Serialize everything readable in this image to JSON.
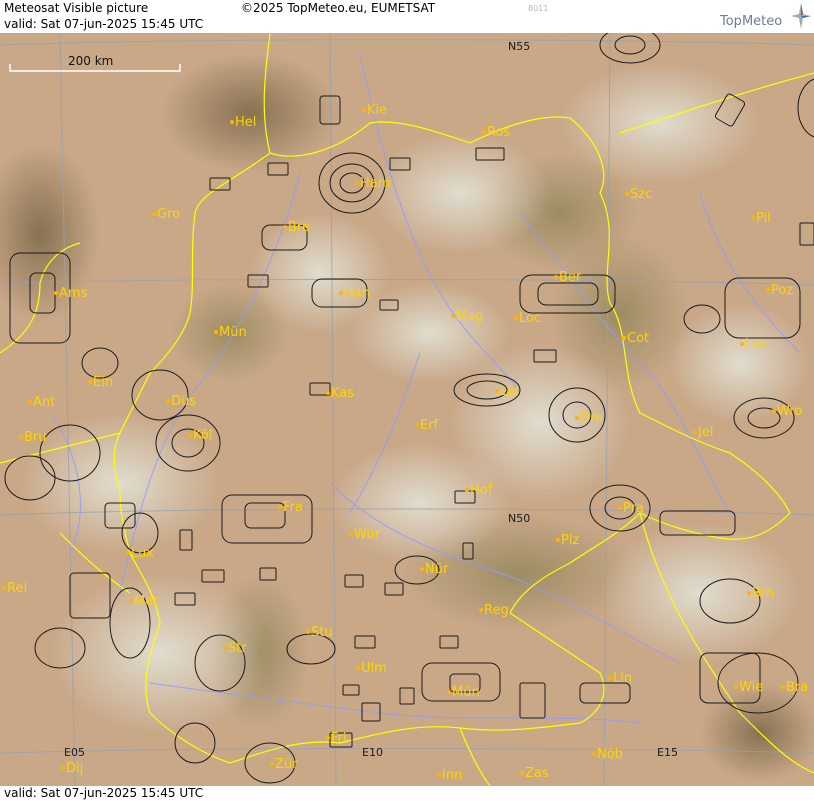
{
  "header": {
    "title": "Meteosat Visible picture",
    "valid": "valid:  Sat  07-jun-2025  15:45 UTC",
    "copyright": "©2025 TopMeteo.eu, EUMETSAT",
    "code": "8011",
    "logo": "TopMeteo"
  },
  "footer": {
    "valid": "valid:  Sat  07-jun-2025  15:45 UTC"
  },
  "scale": {
    "label": "200 km"
  },
  "grid_labels": {
    "n55": "N55",
    "n50": "N50",
    "e05": "E05",
    "e10": "E10",
    "e15": "E15"
  },
  "cities": [
    {
      "label": "Hel"
    },
    {
      "label": "Kie"
    },
    {
      "label": "Ros"
    },
    {
      "label": "Ham"
    },
    {
      "label": "Szc"
    },
    {
      "label": "Gro"
    },
    {
      "label": "Bre"
    },
    {
      "label": "Pil"
    },
    {
      "label": "Ams"
    },
    {
      "label": "Han"
    },
    {
      "label": "Ber"
    },
    {
      "label": "Poz"
    },
    {
      "label": "Mün"
    },
    {
      "label": "Mag"
    },
    {
      "label": "Loc"
    },
    {
      "label": "Cot"
    },
    {
      "label": "Les"
    },
    {
      "label": "Ein"
    },
    {
      "label": "Kas"
    },
    {
      "label": "Lei"
    },
    {
      "label": "Ant"
    },
    {
      "label": "Düs"
    },
    {
      "label": "Dre"
    },
    {
      "label": "Wro"
    },
    {
      "label": "Bru"
    },
    {
      "label": "Köl"
    },
    {
      "label": "Erf"
    },
    {
      "label": "Jel"
    },
    {
      "label": "Hof"
    },
    {
      "label": "Fra"
    },
    {
      "label": "Pra"
    },
    {
      "label": "Wür"
    },
    {
      "label": "Plz"
    },
    {
      "label": "Lux"
    },
    {
      "label": "Nür"
    },
    {
      "label": "Rei"
    },
    {
      "label": "Met"
    },
    {
      "label": "Reg"
    },
    {
      "label": "Brn"
    },
    {
      "label": "Stu"
    },
    {
      "label": "Str"
    },
    {
      "label": "Ulm"
    },
    {
      "label": "Lin"
    },
    {
      "label": "Mün"
    },
    {
      "label": "Wie"
    },
    {
      "label": "Bra"
    },
    {
      "label": "Fri"
    },
    {
      "label": "Nöb"
    },
    {
      "label": "Dij"
    },
    {
      "label": "Zür"
    },
    {
      "label": "Inn"
    },
    {
      "label": "Zas"
    }
  ],
  "colors": {
    "land": "#c8a887",
    "border": "#ffff00",
    "rivers": "#8d9bff",
    "grid": "#9aa0aa",
    "label": "#ffd400"
  }
}
